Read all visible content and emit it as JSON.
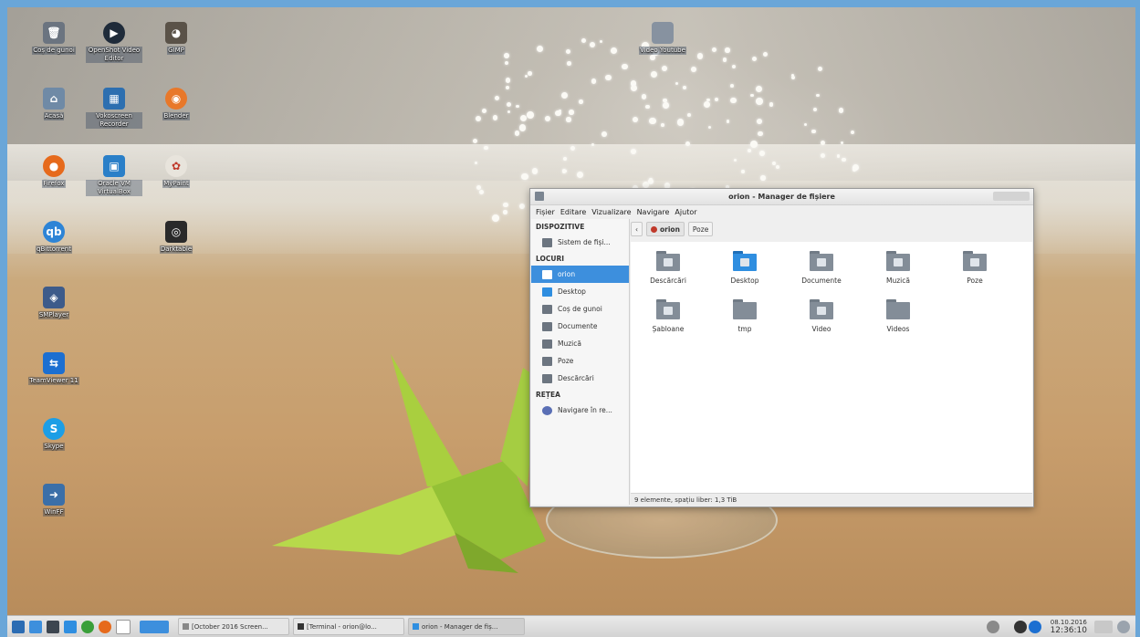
{
  "desktop": {
    "icons": [
      {
        "label": "Coș de gunoi",
        "icon": "trash-icon",
        "color": "#6b7480"
      },
      {
        "label": "OpenShot Video Editor",
        "icon": "openshot-icon",
        "color": "#1f2b3a"
      },
      {
        "label": "GIMP",
        "icon": "gimp-icon",
        "color": "#5a5248"
      },
      {
        "label": "Video Youtube",
        "icon": "folder-icon",
        "color": "#8792a0"
      },
      {
        "label": "Acasă",
        "icon": "home-folder-icon",
        "color": "#6f8aa6"
      },
      {
        "label": "Vokoscreen Recorder",
        "icon": "vokoscreen-icon",
        "color": "#2d6fb0"
      },
      {
        "label": "Blender",
        "icon": "blender-icon",
        "color": "#e8782a"
      },
      {
        "label": "Firefox",
        "icon": "firefox-icon",
        "color": "#e66a1c"
      },
      {
        "label": "Oracle VM VirtualBox",
        "icon": "virtualbox-icon",
        "color": "#2a7fc8"
      },
      {
        "label": "MyPaint",
        "icon": "mypaint-icon",
        "color": "#e8e4dc"
      },
      {
        "label": "qBittorrent",
        "icon": "qbittorrent-icon",
        "color": "#2d84d6"
      },
      {
        "label": "Darktable",
        "icon": "darktable-icon",
        "color": "#2a2a2a"
      },
      {
        "label": "SMPlayer",
        "icon": "smplayer-icon",
        "color": "#3d5b8a"
      },
      {
        "label": "TeamViewer 11",
        "icon": "teamviewer-icon",
        "color": "#1c6fd1"
      },
      {
        "label": "Skype",
        "icon": "skype-icon",
        "color": "#1c9ee6"
      },
      {
        "label": "WinFF",
        "icon": "winff-icon",
        "color": "#3b6fa8"
      }
    ]
  },
  "file_manager": {
    "title": "orion - Manager de fișiere",
    "menu": [
      "Fișier",
      "Editare",
      "Vizualizare",
      "Navigare",
      "Ajutor"
    ],
    "sidebar": {
      "sections": [
        {
          "heading": "DISPOZITIVE",
          "items": [
            {
              "label": "Sistem de fiși...",
              "icon": "drive-icon"
            }
          ]
        },
        {
          "heading": "LOCURI",
          "items": [
            {
              "label": "orion",
              "icon": "home-icon",
              "active": true
            },
            {
              "label": "Desktop",
              "icon": "desktop-icon"
            },
            {
              "label": "Coș de gunoi",
              "icon": "trash-icon"
            },
            {
              "label": "Documente",
              "icon": "folder-icon"
            },
            {
              "label": "Muzică",
              "icon": "folder-icon"
            },
            {
              "label": "Poze",
              "icon": "folder-icon"
            },
            {
              "label": "Descărcări",
              "icon": "folder-icon"
            }
          ]
        },
        {
          "heading": "REȚEA",
          "items": [
            {
              "label": "Navigare în re...",
              "icon": "network-icon"
            }
          ]
        }
      ]
    },
    "pathbar": {
      "back": "‹",
      "current": "orion",
      "next": "Poze"
    },
    "items": [
      {
        "label": "Descărcări",
        "emblem": "download"
      },
      {
        "label": "Desktop",
        "emblem": "desktop",
        "accent": "#2f8ee0"
      },
      {
        "label": "Documente",
        "emblem": "document"
      },
      {
        "label": "Muzică",
        "emblem": "music"
      },
      {
        "label": "Poze",
        "emblem": "picture"
      },
      {
        "label": "Șabloane",
        "emblem": "template"
      },
      {
        "label": "tmp",
        "emblem": "none"
      },
      {
        "label": "Video",
        "emblem": "video"
      },
      {
        "label": "Videos",
        "emblem": "none"
      }
    ],
    "status": "9 elemente, spațiu liber: 1,3 TiB"
  },
  "taskbar": {
    "tasks": [
      {
        "label": "[October 2016 Screen...",
        "active": false
      },
      {
        "label": "[Terminal - orion@lo...",
        "active": false
      },
      {
        "label": "orion - Manager de fiș...",
        "active": true
      }
    ],
    "clock_date": "08.10.2016",
    "clock_time": "12:36:10"
  }
}
